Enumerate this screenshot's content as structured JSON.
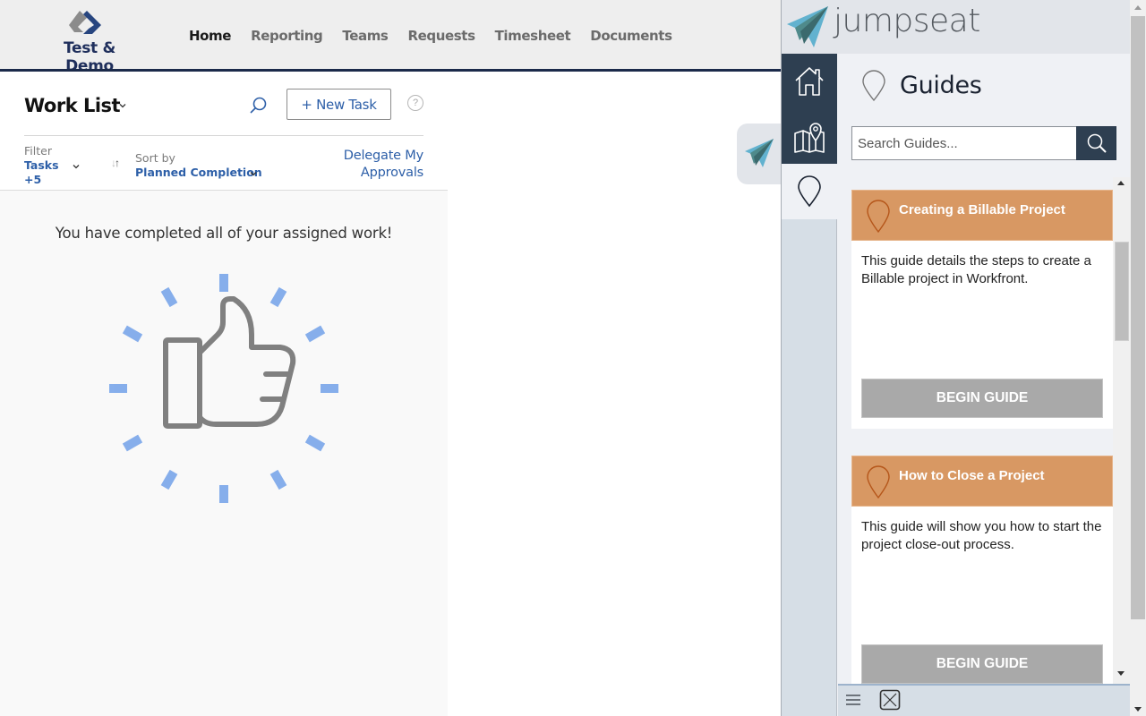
{
  "app": {
    "brand": "Test & Demo",
    "nav": [
      {
        "label": "Home",
        "active": true
      },
      {
        "label": "Reporting",
        "active": false
      },
      {
        "label": "Teams",
        "active": false
      },
      {
        "label": "Requests",
        "active": false
      },
      {
        "label": "Timesheet",
        "active": false
      },
      {
        "label": "Documents",
        "active": false
      }
    ]
  },
  "worklist": {
    "title": "Work List",
    "new_task_label": "+ New Task",
    "help_label": "?",
    "filter": {
      "label": "Filter",
      "value_line1": "Tasks",
      "value_line2": "+5"
    },
    "sort": {
      "label": "Sort by",
      "value": "Planned Completion"
    },
    "delegate_line1": "Delegate My",
    "delegate_line2": "Approvals",
    "empty_message": "You have completed all of your assigned work!"
  },
  "jumpseat": {
    "brand": "jumpseat",
    "section_title": "Guides",
    "search": {
      "placeholder": "Search Guides...",
      "value": ""
    },
    "rail": [
      {
        "name": "home",
        "active": false
      },
      {
        "name": "map",
        "active": false
      },
      {
        "name": "guides",
        "active": true
      }
    ],
    "guides": [
      {
        "title": "Creating a Billable Project",
        "description": "This guide details the steps to create a Billable project in Workfront.",
        "button": "BEGIN GUIDE"
      },
      {
        "title": "How to Close a Project",
        "description": "This guide will show you how to start the project close-out process.",
        "button": "BEGIN GUIDE"
      }
    ],
    "colors": {
      "rail_dark": "#2e3f51",
      "card_header": "#d89863",
      "button": "#a9a9a9"
    }
  },
  "colors": {
    "link_blue": "#2d5fa8",
    "brand_navy": "#1b2a4a",
    "ray_blue": "#7aa6ea"
  }
}
